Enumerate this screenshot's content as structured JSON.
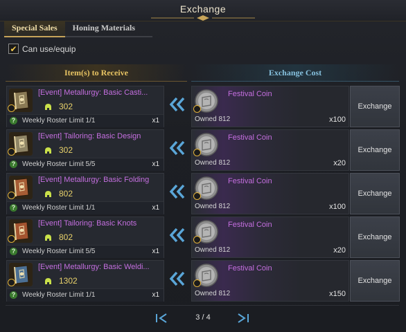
{
  "window": {
    "title": "Exchange"
  },
  "tabs": [
    {
      "label": "Special Sales",
      "active": true
    },
    {
      "label": "Honing Materials",
      "active": false
    }
  ],
  "filter": {
    "label": "Can use/equip",
    "checked": true
  },
  "columns": {
    "receive": "Item(s) to Receive",
    "cost": "Exchange Cost"
  },
  "rows": [
    {
      "item_name": "[Event] Metallurgy: Basic Casti...",
      "item_icon": "book-gold-icon",
      "level": "302",
      "limit": "Weekly Roster Limit 1/1",
      "receive_qty": "x1",
      "cost_name": "Festival Coin",
      "owned": "Owned 812",
      "cost_qty": "x100",
      "button": "Exchange"
    },
    {
      "item_name": "[Event] Tailoring: Basic Design",
      "item_icon": "book-tan-icon",
      "level": "302",
      "limit": "Weekly Roster Limit 5/5",
      "receive_qty": "x1",
      "cost_name": "Festival Coin",
      "owned": "Owned 812",
      "cost_qty": "x20",
      "button": "Exchange"
    },
    {
      "item_name": "[Event] Metallurgy: Basic Folding",
      "item_icon": "book-orange-icon",
      "level": "802",
      "limit": "Weekly Roster Limit 1/1",
      "receive_qty": "x1",
      "cost_name": "Festival Coin",
      "owned": "Owned 812",
      "cost_qty": "x100",
      "button": "Exchange"
    },
    {
      "item_name": "[Event] Tailoring: Basic Knots",
      "item_icon": "book-brown-icon",
      "level": "802",
      "limit": "Weekly Roster Limit 5/5",
      "receive_qty": "x1",
      "cost_name": "Festival Coin",
      "owned": "Owned 812",
      "cost_qty": "x20",
      "button": "Exchange"
    },
    {
      "item_name": "[Event] Metallurgy: Basic Weldi...",
      "item_icon": "book-blue-icon",
      "level": "1302",
      "limit": "Weekly Roster Limit 1/1",
      "receive_qty": "x1",
      "cost_name": "Festival Coin",
      "owned": "Owned 812",
      "cost_qty": "x150",
      "button": "Exchange"
    }
  ],
  "pagination": {
    "text": "3 / 4"
  },
  "colors": {
    "item_name": "#c56fe0",
    "level": "#e9d26b",
    "receive_header": "#e8c463",
    "cost_header": "#86c0dd",
    "book_colors": [
      "#8a7a55",
      "#8f8566",
      "#a65d35",
      "#a4542f",
      "#4b6f93"
    ]
  }
}
